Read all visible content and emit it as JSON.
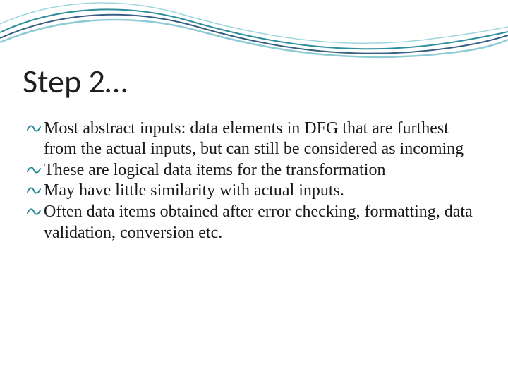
{
  "slide": {
    "title": "Step 2…",
    "bullets": [
      "Most abstract inputs: data elements in DFG that are furthest from the actual inputs, but can still be considered as incoming",
      "These are logical data items for the transformation",
      "May have little similarity with actual inputs.",
      "Often data items obtained after error checking, formatting, data validation, conversion etc."
    ],
    "colors": {
      "accent": "#2b8a97",
      "wave1": "#2f8e9b",
      "wave2": "#3a5f84",
      "wave3": "#8fcbd4"
    }
  }
}
